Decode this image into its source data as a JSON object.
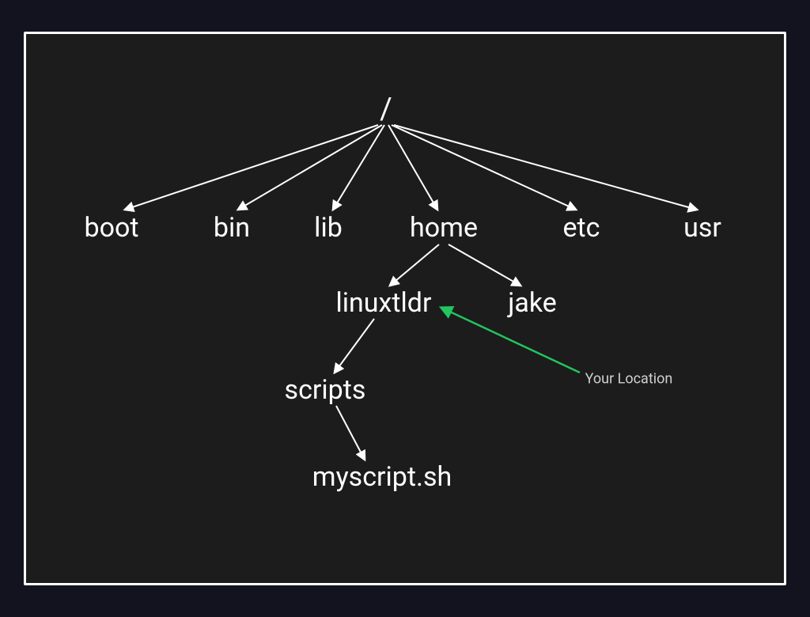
{
  "tree": {
    "root": "/",
    "level1": {
      "boot": "boot",
      "bin": "bin",
      "lib": "lib",
      "home": "home",
      "etc": "etc",
      "usr": "usr"
    },
    "level2": {
      "linuxtldr": "linuxtldr",
      "jake": "jake"
    },
    "level3": {
      "scripts": "scripts"
    },
    "level4": {
      "myscript": "myscript.sh"
    }
  },
  "annotation": {
    "your_location": "Your Location"
  },
  "colors": {
    "arrow": "#ffffff",
    "highlight": "#22c55e"
  }
}
